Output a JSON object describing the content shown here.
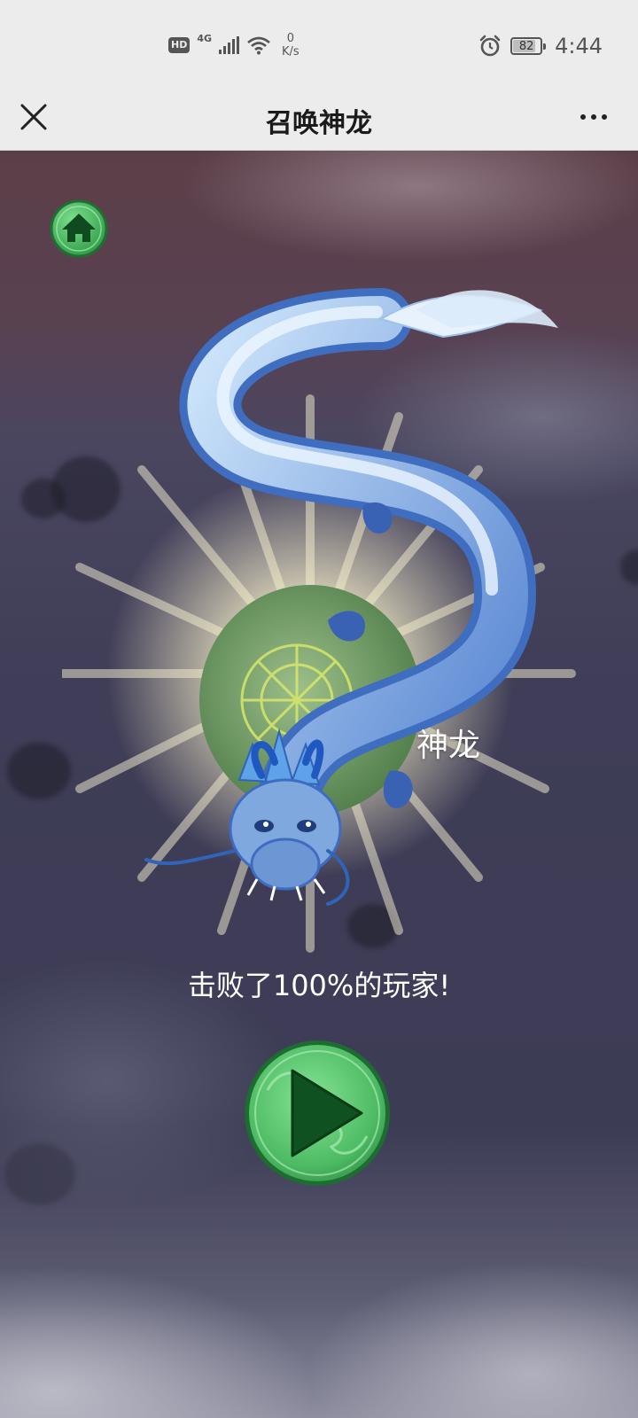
{
  "status_bar": {
    "hd_label": "HD",
    "network_type": "4G",
    "speed_value": "0",
    "speed_unit": "K/s",
    "battery_percent": "82",
    "time": "4:44",
    "icons": [
      "hd-icon",
      "signal-icon",
      "wifi-icon",
      "alarm-icon",
      "battery-icon"
    ]
  },
  "title_bar": {
    "title": "召唤神龙",
    "close_icon": "close-icon",
    "more_icon": "more-icon"
  },
  "game": {
    "dragon_name": "神龙",
    "result_text": "击败了100%的玩家!",
    "home_icon": "home-icon",
    "play_icon": "play-icon"
  },
  "colors": {
    "status_bg": "#ececec",
    "game_bg_top": "#5b3f48",
    "game_bg_mid": "#3e3d56",
    "button_green": "#5ccb72",
    "dragon_blue": "#5b8bd6",
    "text_white": "#ffffff"
  }
}
